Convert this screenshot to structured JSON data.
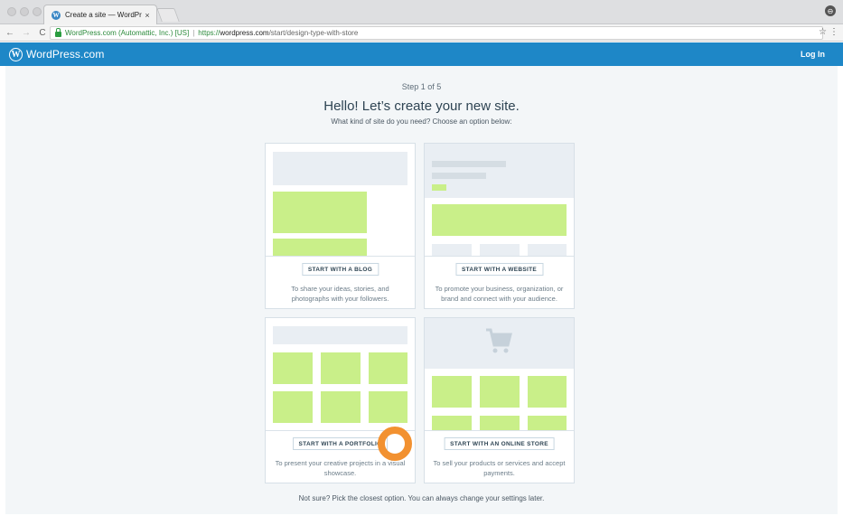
{
  "browser": {
    "tab_title": "Create a site — WordPress.co",
    "tab_close": "×",
    "url_ev": "WordPress.com (Automattic, Inc.) [US]",
    "url_scheme": "https://",
    "url_host": "wordpress.com",
    "url_path": "/start/design-type-with-store",
    "back": "←",
    "forward": "→",
    "reload": "C",
    "star": "☆",
    "menu": "⋮",
    "profile": "⊖"
  },
  "masterbar": {
    "brand": "WordPress.com",
    "login": "Log In",
    "logo_letter": "W"
  },
  "main": {
    "step": "Step 1 of 5",
    "headline": "Hello! Let’s create your new site.",
    "subhead": "What kind of site do you need? Choose an option below:",
    "footer": "Not sure? Pick the closest option. You can always change your settings later."
  },
  "cards": [
    {
      "button": "START WITH A BLOG",
      "desc": "To share your ideas, stories, and photographs with your followers."
    },
    {
      "button": "START WITH A WEBSITE",
      "desc": "To promote your business, organization, or brand and connect with your audience."
    },
    {
      "button": "START WITH A PORTFOLIO",
      "desc": "To present your creative projects in a visual showcase."
    },
    {
      "button": "START WITH AN ONLINE STORE",
      "desc": "To sell your products or services and accept payments."
    }
  ],
  "colors": {
    "accent": "#1e87c7",
    "placeholder_green": "#c9ef89",
    "placeholder_gray": "#e9eef3",
    "click_indicator": "#f29130"
  }
}
